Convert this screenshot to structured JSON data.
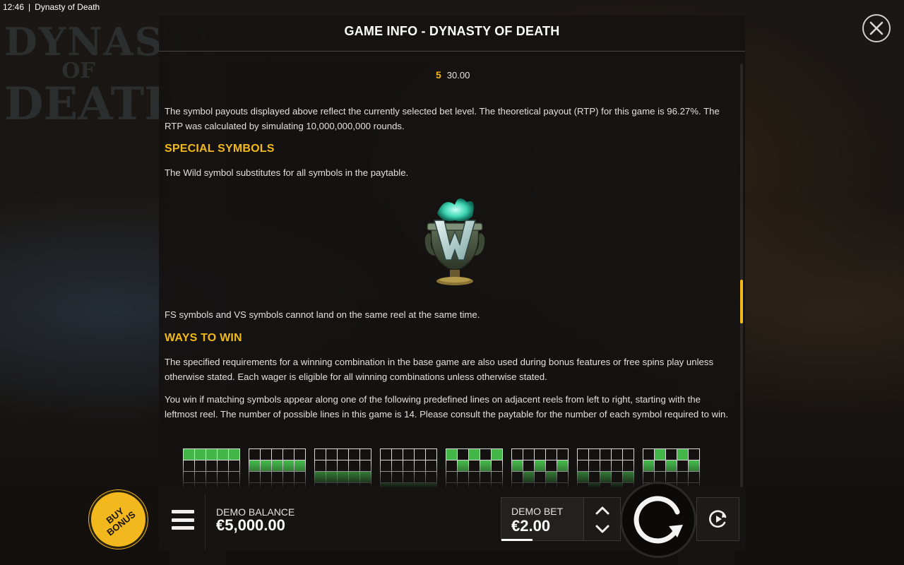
{
  "status_bar": {
    "time": "12:46",
    "separator": "|",
    "app_name": "Dynasty of Death"
  },
  "background": {
    "logo_line1": "DYNASTY",
    "logo_line2": "OF",
    "logo_line3": "DEATH"
  },
  "panel": {
    "title": "GAME INFO - DYNASTY OF DEATH",
    "paytable_row": {
      "count": "5",
      "payout": "30.00"
    },
    "rtp_text": "The symbol payouts displayed above reflect the currently selected bet level. The theoretical payout (RTP) for this game is 96.27%. The RTP was calculated by simulating 10,000,000,000 rounds.",
    "special_symbols": {
      "heading": "SPECIAL SYMBOLS",
      "wild_text": "The Wild symbol substitutes for all symbols in the paytable.",
      "fs_vs_text": "FS symbols and VS symbols cannot land on the same reel at the same time."
    },
    "ways_to_win": {
      "heading": "WAYS TO WIN",
      "para1": "The specified requirements for a winning combination in the base game are also used during bonus features or free spins play unless otherwise stated. Each wager is eligible for all winning combinations unless otherwise stated.",
      "para2": "You win if matching symbols appear along one of the following predefined lines on adjacent reels from left to right, starting with the leftmost reel. The number of possible lines in this game is 14. Please consult the paytable for the number of each symbol required to win."
    },
    "paylines": [
      [
        0,
        0,
        0,
        0,
        0
      ],
      [
        1,
        1,
        1,
        1,
        1
      ],
      [
        2,
        2,
        2,
        2,
        2
      ],
      [
        3,
        3,
        3,
        3,
        3
      ],
      [
        0,
        1,
        0,
        1,
        0
      ],
      [
        1,
        2,
        1,
        2,
        1
      ],
      [
        2,
        3,
        2,
        3,
        2
      ],
      [
        1,
        0,
        1,
        0,
        1
      ]
    ],
    "scroll_fraction": 0.51
  },
  "bottom_bar": {
    "balance_label": "DEMO BALANCE",
    "balance_value": "€5,000.00",
    "bet_label": "DEMO BET",
    "bet_value": "€2.00",
    "buy_bonus_line1": "BUY",
    "buy_bonus_line2": "BONUS"
  },
  "colors": {
    "accent": "#f2b91b",
    "line_on": "#44b549",
    "buy_bonus": "#f4b81f"
  },
  "icons": [
    "close-icon",
    "menu-icon",
    "chevron-up-icon",
    "chevron-down-icon",
    "spin-icon",
    "autoplay-icon",
    "wild-symbol"
  ]
}
